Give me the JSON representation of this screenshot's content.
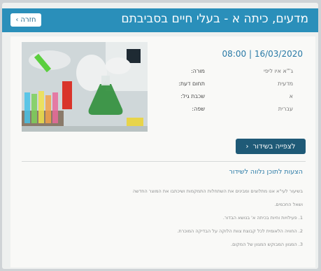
{
  "header": {
    "title": "מדעים, כיתה א - בעלי חיים בסביבתם",
    "back_label": "חזרה"
  },
  "broadcast": {
    "date": "16/03/2020",
    "time": "08:00",
    "details": [
      {
        "label": "מורה:",
        "value": "ג'\"א איו ליפי"
      },
      {
        "label": "תחום דעת:",
        "value": "מדעית"
      },
      {
        "label": "שכבת גיל:",
        "value": "א"
      },
      {
        "label": "שפה:",
        "value": "עברית"
      }
    ],
    "watch_label": "לצפייה בשידור"
  },
  "suggestions": {
    "title": "הצעות לתוכן נלווה לשידור",
    "paragraphs": [
      "בשיעור לעי\"א אנו מתלוצים ומבינים את השתחלות התמקמות ושיכתבו את המוצר החדשה",
      "ושאל החכמים.",
      "1. פעילויות וחיות בכיתה א' בנושא הבדור.",
      "2. החוויה הלאומית לכל קבוצת צוות הלוקה על הבדיקה המוכרת.",
      "3. המגוון המבוקש המגוון של המקום."
    ]
  },
  "colors": {
    "header": "#2a8fba",
    "button": "#1f5a77",
    "accent_text": "#2879a6"
  }
}
